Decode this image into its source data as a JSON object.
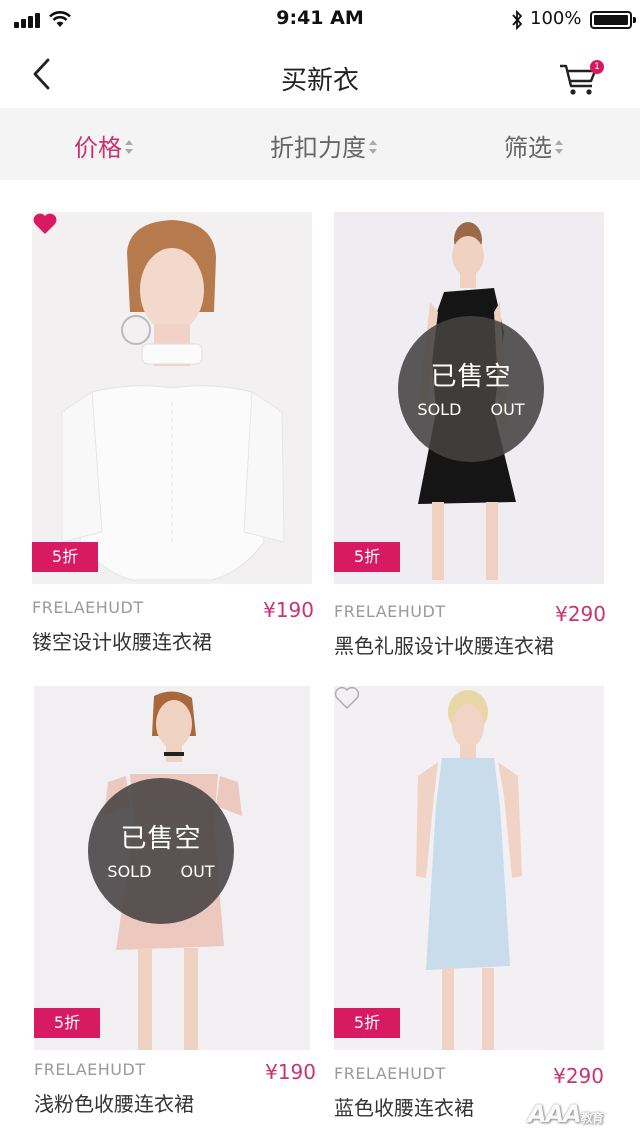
{
  "status_bar": {
    "time": "9:41 AM",
    "battery": "100%",
    "battery_level": 1.0
  },
  "nav": {
    "title": "买新衣",
    "cart_badge": "1"
  },
  "filters": [
    {
      "label": "价格",
      "active": true
    },
    {
      "label": "折扣力度",
      "active": false
    },
    {
      "label": "筛选",
      "active": false
    }
  ],
  "products": [
    {
      "brand": "FRELAEHUDT",
      "price": "¥190",
      "name": "镂空设计收腰连衣裙",
      "discount": "5折",
      "sold_out": false,
      "favorited": true
    },
    {
      "brand": "FRELAEHUDT",
      "price": "¥290",
      "name": "黑色礼服设计收腰连衣裙",
      "discount": "5折",
      "sold_out": true,
      "favorited": false
    },
    {
      "brand": "FRELAEHUDT",
      "price": "¥190",
      "name": "浅粉色收腰连衣裙",
      "discount": "5折",
      "sold_out": true,
      "favorited": false
    },
    {
      "brand": "FRELAEHUDT",
      "price": "¥290",
      "name": "蓝色收腰连衣裙",
      "discount": "5折",
      "sold_out": false,
      "favorited": false
    }
  ],
  "sold_out": {
    "zh": "已售空",
    "en": "SOLD OUT"
  },
  "watermark": {
    "main": "AAA",
    "sub": "教育"
  },
  "colors": {
    "accent": "#c93371",
    "badge": "#d71a62"
  }
}
